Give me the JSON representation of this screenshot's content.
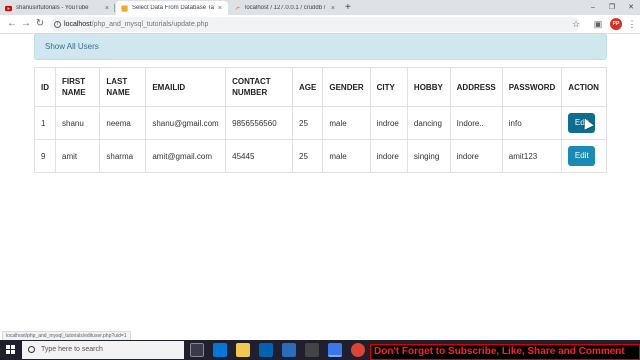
{
  "browser": {
    "tabs": [
      {
        "label": "shanusirtutorials - YouTube",
        "close": "×"
      },
      {
        "label": "Select Data From Database Table",
        "close": "×"
      },
      {
        "label": "localhost / 127.0.0.1 / cruddb / u",
        "close": "×"
      }
    ],
    "new_tab": "+",
    "window_controls": {
      "minimize": "–",
      "restore": "❐",
      "close": "✕"
    },
    "nav": {
      "back": "←",
      "forward": "→",
      "reload": "↻"
    },
    "address": {
      "host": "localhost",
      "path": "/php_and_mysql_tutorials/update.php"
    },
    "profile_initials": "PP"
  },
  "page": {
    "alert_text": "Show All Users",
    "table": {
      "headers": [
        "ID",
        "FIRST NAME",
        "LAST NAME",
        "EMAILID",
        "CONTACT NUMBER",
        "AGE",
        "GENDER",
        "CITY",
        "HOBBY",
        "ADDRESS",
        "PASSWORD",
        "ACTION"
      ],
      "rows": [
        {
          "id": "1",
          "first": "shanu",
          "last": "neema",
          "email": "shanu@gmail.com",
          "contact": "9856556560",
          "age": "25",
          "gender": "male",
          "city": "indroe",
          "hobby": "dancing",
          "address": "Indore..",
          "password": "info",
          "action": "Edit"
        },
        {
          "id": "9",
          "first": "amit",
          "last": "sharma",
          "email": "amit@gmail.com",
          "contact": "45445",
          "age": "25",
          "gender": "male",
          "city": "indore",
          "hobby": "singing",
          "address": "indore",
          "password": "amit123",
          "action": "Edit"
        }
      ]
    },
    "status_url": "localhost/php_and_mysql_tutorials/edituser.php?uid=1"
  },
  "taskbar": {
    "search_placeholder": "Type here to search",
    "banner": "Don't Forget to Subscribe, Like, Share and Comment"
  },
  "colors": {
    "button": "#1a8ab4",
    "alert_bg": "#d1e7f0",
    "alert_text": "#31708f",
    "banner_text": "#ff2020"
  }
}
